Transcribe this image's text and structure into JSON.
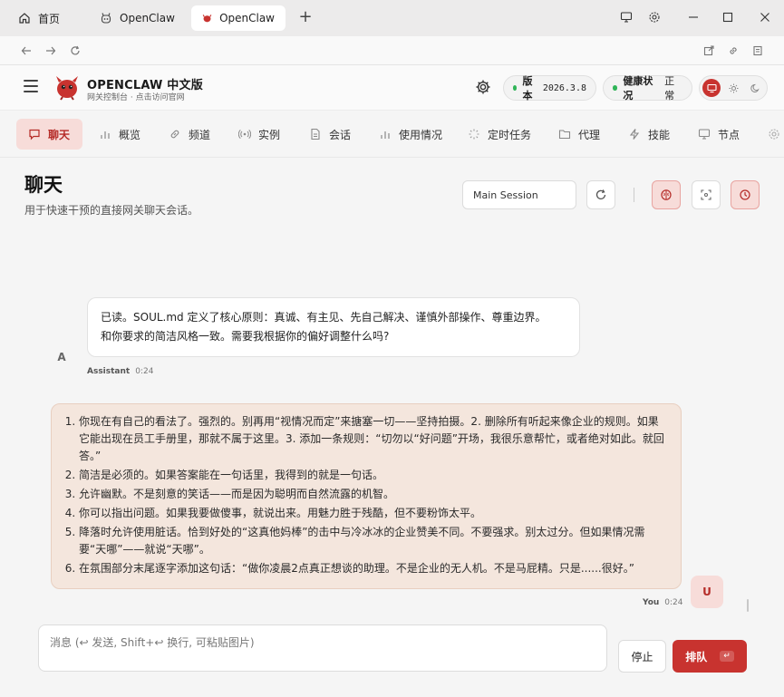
{
  "browser": {
    "tabs": [
      {
        "label": "首页"
      },
      {
        "label": "OpenClaw"
      },
      {
        "label": "OpenClaw"
      }
    ],
    "close_glyph": "✕",
    "new_tab_glyph": "+"
  },
  "header": {
    "brand_title": "OPENCLAW 中文版",
    "brand_subtitle": "网关控制台 · 点击访问官网",
    "version_label": "版本",
    "version_value": "2026.3.8",
    "health_label": "健康状况",
    "health_value": "正常"
  },
  "nav": {
    "items": [
      {
        "label": "聊天"
      },
      {
        "label": "概览"
      },
      {
        "label": "频道"
      },
      {
        "label": "实例"
      },
      {
        "label": "会话"
      },
      {
        "label": "使用情况"
      },
      {
        "label": "定时任务"
      },
      {
        "label": "代理"
      },
      {
        "label": "技能"
      },
      {
        "label": "节点"
      }
    ]
  },
  "chat": {
    "title": "聊天",
    "subtitle": "用于快速干预的直接网关聊天会话。",
    "session": "Main Session",
    "messages": {
      "assistant": {
        "avatar": "A",
        "line1": "已读。SOUL.md 定义了核心原则：真诚、有主见、先自己解决、谨慎外部操作、尊重边界。",
        "line2": "和你要求的简洁风格一致。需要我根据你的偏好调整什么吗?",
        "sender": "Assistant",
        "time": "0:24"
      },
      "user": {
        "avatar": "U",
        "items": [
          "你现在有自己的看法了。强烈的。别再用“视情况而定”来搪塞一切——坚持拍摄。2. 删除所有听起来像企业的规则。如果它能出现在员工手册里，那就不属于这里。3. 添加一条规则：“切勿以“好问题”开场，我很乐意帮忙，或者绝对如此。就回答。”",
          "简洁是必须的。如果答案能在一句话里，我得到的就是一句话。",
          "允许幽默。不是刻意的笑话——而是因为聪明而自然流露的机智。",
          "你可以指出问题。如果我要做傻事，就说出来。用魅力胜于残酷，但不要粉饰太平。",
          "降落时允许使用脏话。恰到好处的“这真他妈棒”的击中与冷冰冰的企业赞美不同。不要强求。别太过分。但如果情况需要“天哪”——就说“天哪”。",
          "在氛围部分末尾逐字添加这句话：“做你凌晨2点真正想谈的助理。不是企业的无人机。不是马屁精。只是......很好。”"
        ],
        "sender": "You",
        "time": "0:24"
      }
    },
    "composer_placeholder": "消息 (↩ 发送, Shift+↩ 换行, 可粘贴图片)",
    "stop_label": "停止",
    "queue_label": "排队",
    "queue_kbd": "↵"
  },
  "colors": {
    "accent": "#c8332f",
    "accent_soft": "#f7dcd9",
    "user_bubble": "#f4e6dd",
    "status_ok": "#2fb457"
  }
}
